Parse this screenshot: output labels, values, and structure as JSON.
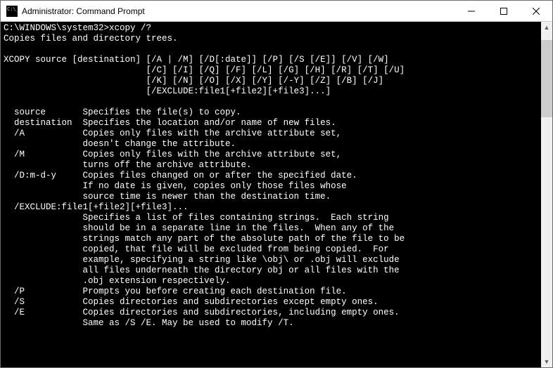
{
  "window": {
    "title": "Administrator: Command Prompt"
  },
  "console": {
    "prompt": "C:\\WINDOWS\\system32>",
    "command": "xcopy /?",
    "summary": "Copies files and directory trees.",
    "usage": [
      "XCOPY source [destination] [/A | /M] [/D[:date]] [/P] [/S [/E]] [/V] [/W]",
      "                           [/C] [/I] [/Q] [/F] [/L] [/G] [/H] [/R] [/T] [/U]",
      "                           [/K] [/N] [/O] [/X] [/Y] [/-Y] [/Z] [/B] [/J]",
      "                           [/EXCLUDE:file1[+file2][+file3]...]"
    ],
    "params": [
      {
        "name": "source",
        "desc": [
          "Specifies the file(s) to copy."
        ]
      },
      {
        "name": "destination",
        "desc": [
          "Specifies the location and/or name of new files."
        ]
      },
      {
        "name": "/A",
        "desc": [
          "Copies only files with the archive attribute set,",
          "doesn't change the attribute."
        ]
      },
      {
        "name": "/M",
        "desc": [
          "Copies only files with the archive attribute set,",
          "turns off the archive attribute."
        ]
      },
      {
        "name": "/D:m-d-y",
        "desc": [
          "Copies files changed on or after the specified date.",
          "If no date is given, copies only those files whose",
          "source time is newer than the destination time."
        ]
      },
      {
        "name": "/EXCLUDE:file1[+file2][+file3]...",
        "fullline": true,
        "desc": [
          "Specifies a list of files containing strings.  Each string",
          "should be in a separate line in the files.  When any of the",
          "strings match any part of the absolute path of the file to be",
          "copied, that file will be excluded from being copied.  For",
          "example, specifying a string like \\obj\\ or .obj will exclude",
          "all files underneath the directory obj or all files with the",
          ".obj extension respectively."
        ]
      },
      {
        "name": "/P",
        "desc": [
          "Prompts you before creating each destination file."
        ]
      },
      {
        "name": "/S",
        "desc": [
          "Copies directories and subdirectories except empty ones."
        ]
      },
      {
        "name": "/E",
        "desc": [
          "Copies directories and subdirectories, including empty ones.",
          "Same as /S /E. May be used to modify /T."
        ]
      }
    ]
  }
}
